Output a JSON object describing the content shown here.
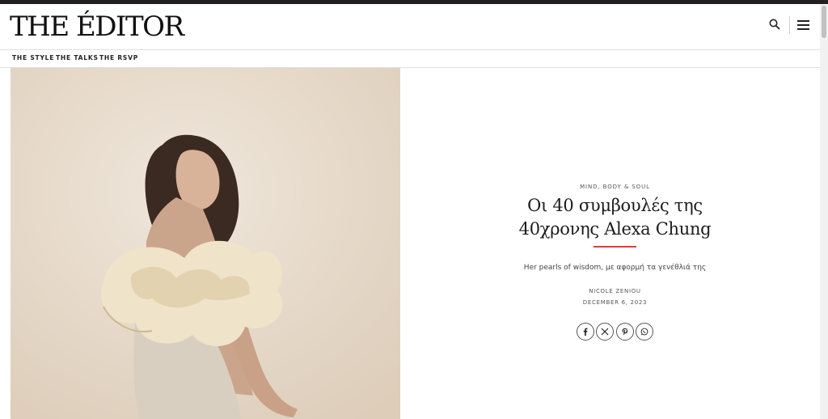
{
  "brand": {
    "logo": "THE ÉDITOR"
  },
  "header": {
    "search_icon": "search-icon",
    "menu_icon": "hamburger-menu-icon"
  },
  "nav": {
    "items": [
      {
        "label": "THE STYLE"
      },
      {
        "label": "THE TALKS"
      },
      {
        "label": "THE RSVP"
      }
    ]
  },
  "article": {
    "category": "MIND, BODY & SOUL",
    "title_line1": "Οι 40 συμβουλές της",
    "title_line2": "40χρονης Alexa Chung",
    "subtitle": "Her pearls of wisdom, με αφορμή τα γενέθλιά της",
    "author": "NICOLE ZENIOU",
    "date": "DECEMBER 6, 2023",
    "accent_color": "#e23b3b"
  },
  "share": [
    {
      "icon": "facebook-icon"
    },
    {
      "icon": "x-icon"
    },
    {
      "icon": "pinterest-icon"
    },
    {
      "icon": "whatsapp-icon"
    }
  ]
}
